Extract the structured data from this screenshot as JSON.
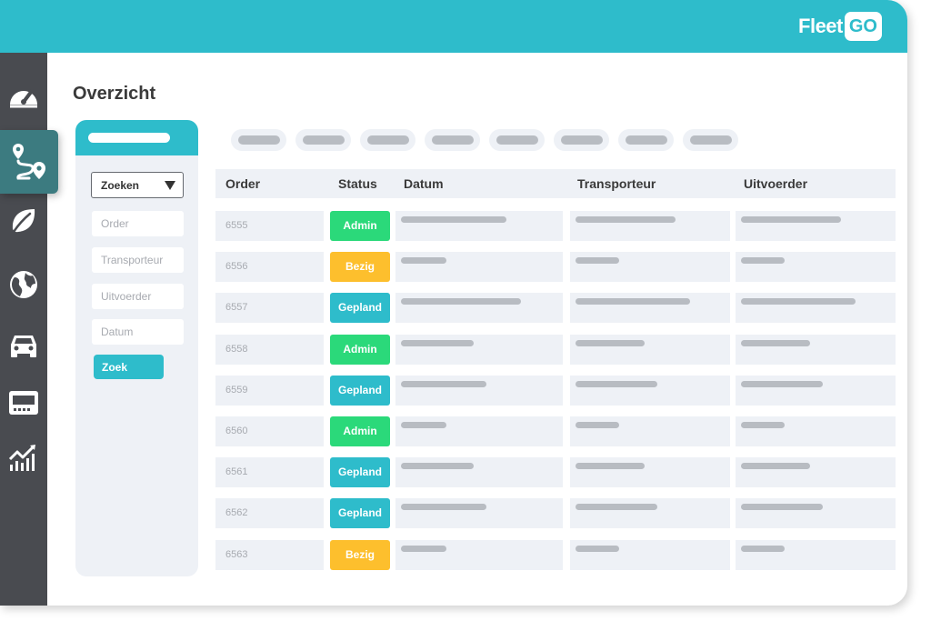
{
  "brand": {
    "part1": "Fleet",
    "part2": "GO",
    "accent": "#2ebccb"
  },
  "sidebar": {
    "items": [
      {
        "icon": "speedometer-icon"
      },
      {
        "icon": "route-icon",
        "active": true
      },
      {
        "icon": "leaf-icon"
      },
      {
        "icon": "globe-icon"
      },
      {
        "icon": "car-icon"
      },
      {
        "icon": "card-reader-icon"
      },
      {
        "icon": "chart-icon"
      }
    ]
  },
  "page": {
    "title": "Overzicht"
  },
  "filter": {
    "select_value": "Zoeken",
    "fields": [
      "Order",
      "Transporteur",
      "Uitvoerder",
      "Datum"
    ],
    "search_label": "Zoek"
  },
  "table": {
    "headers": {
      "order": "Order",
      "status": "Status",
      "datum": "Datum",
      "transporteur": "Transporteur",
      "uitvoerder": "Uitvoerder"
    },
    "rows": [
      {
        "order": "6555",
        "status": "Admin"
      },
      {
        "order": "6556",
        "status": "Bezig"
      },
      {
        "order": "6557",
        "status": "Gepland"
      },
      {
        "order": "6558",
        "status": "Admin"
      },
      {
        "order": "6559",
        "status": "Gepland"
      },
      {
        "order": "6560",
        "status": "Admin"
      },
      {
        "order": "6561",
        "status": "Gepland"
      },
      {
        "order": "6562",
        "status": "Gepland"
      },
      {
        "order": "6563",
        "status": "Bezig"
      }
    ]
  },
  "status_colors": {
    "Admin": "#2bd97a",
    "Bezig": "#fdbf2d",
    "Gepland": "#2ebccb"
  }
}
